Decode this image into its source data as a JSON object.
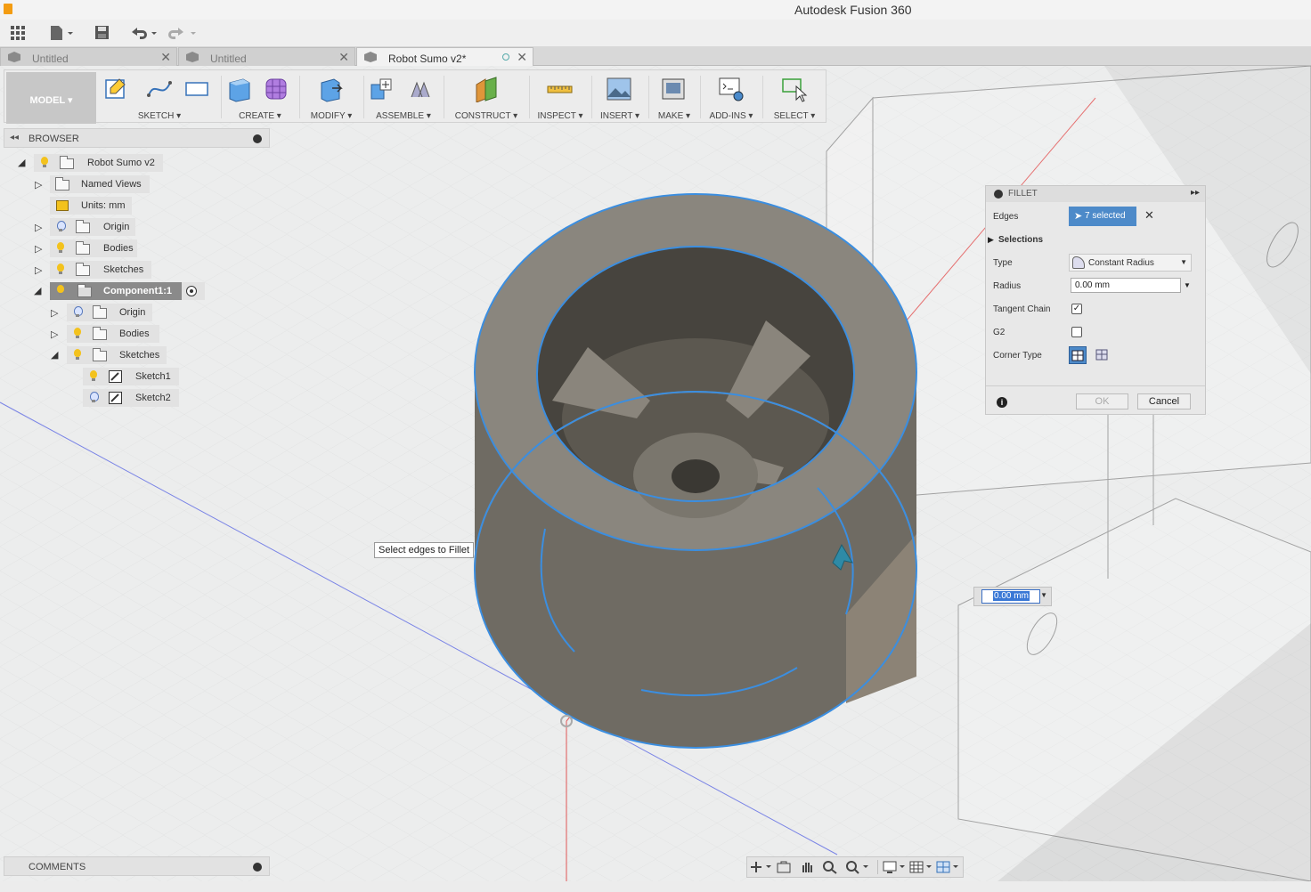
{
  "window": {
    "title": "Autodesk Fusion 360"
  },
  "tabs": [
    {
      "label": "Untitled",
      "active": false
    },
    {
      "label": "Untitled",
      "active": false
    },
    {
      "label": "Robot Sumo v2*",
      "active": true
    }
  ],
  "toolbar": {
    "workspace": "MODEL",
    "groups": [
      "SKETCH",
      "CREATE",
      "MODIFY",
      "ASSEMBLE",
      "CONSTRUCT",
      "INSPECT",
      "INSERT",
      "MAKE",
      "ADD-INS",
      "SELECT"
    ]
  },
  "browser": {
    "title": "BROWSER",
    "root": "Robot Sumo v2",
    "items": [
      {
        "label": "Named Views"
      },
      {
        "label": "Units: mm"
      },
      {
        "label": "Origin"
      },
      {
        "label": "Bodies"
      },
      {
        "label": "Sketches"
      },
      {
        "label": "Component1:1"
      },
      {
        "label": "Origin"
      },
      {
        "label": "Bodies"
      },
      {
        "label": "Sketches"
      },
      {
        "label": "Sketch1"
      },
      {
        "label": "Sketch2"
      }
    ]
  },
  "comments": {
    "title": "COMMENTS"
  },
  "fillet": {
    "title": "FILLET",
    "edges_label": "Edges",
    "edges_value": "7 selected",
    "selections_label": "Selections",
    "type_label": "Type",
    "type_value": "Constant Radius",
    "radius_label": "Radius",
    "radius_value": "0.00 mm",
    "tangent_label": "Tangent Chain",
    "tangent_checked": true,
    "g2_label": "G2",
    "g2_checked": false,
    "corner_label": "Corner Type",
    "ok_label": "OK",
    "cancel_label": "Cancel"
  },
  "viewport": {
    "tooltip": "Select edges to Fillet",
    "radius_input": "0.00 mm"
  },
  "colors": {
    "selection": "#3b8ee0",
    "body": "#6f6b63",
    "accent_button": "#4d8ac9"
  }
}
